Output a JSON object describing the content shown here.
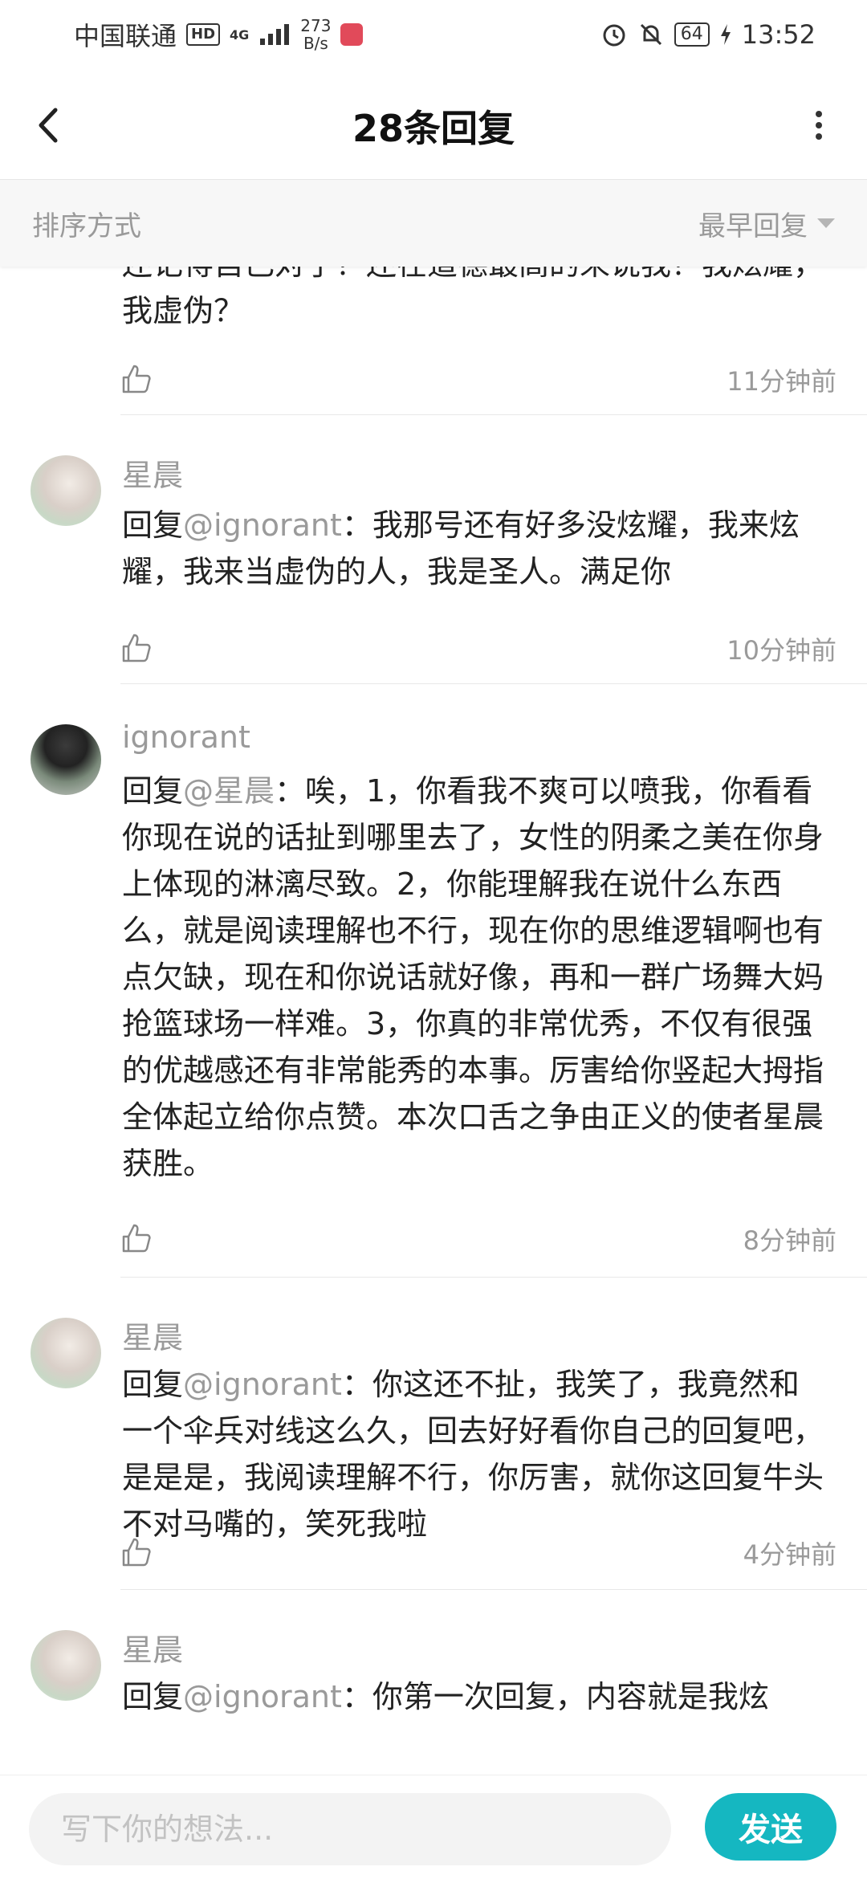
{
  "status_bar": {
    "carrier": "中国联通",
    "hd_badge": "HD",
    "network": "4G",
    "speed_value": "273",
    "speed_unit": "B/s",
    "battery": "64",
    "time": "13:52"
  },
  "header": {
    "title": "28条回复"
  },
  "sort": {
    "label": "排序方式",
    "selected": "最早回复"
  },
  "replies": [
    {
      "content": "还记得自己对了？还在道德最高的来说我？我炫耀，我虚伪？",
      "time": "11分钟前"
    },
    {
      "name": "星晨",
      "prefix": "回复",
      "mention": "@ignorant",
      "text": "：我那号还有好多没炫耀，我来炫耀，我来当虚伪的人，我是圣人。满足你",
      "time": "10分钟前"
    },
    {
      "name": "ignorant",
      "prefix": "回复",
      "mention": "@星晨",
      "text": "：唉，1，你看我不爽可以喷我，你看看你现在说的话扯到哪里去了，女性的阴柔之美在你身上体现的淋漓尽致。2，你能理解我在说什么东西么，就是阅读理解也不行，现在你的思维逻辑啊也有点欠缺，现在和你说话就好像，再和一群广场舞大妈抢篮球场一样难。3，你真的非常优秀，不仅有很强的优越感还有非常能秀的本事。厉害给你竖起大拇指全体起立给你点赞。本次口舌之争由正义的使者星晨获胜。",
      "time": "8分钟前"
    },
    {
      "name": "星晨",
      "prefix": "回复",
      "mention": "@ignorant",
      "text": "：你这还不扯，我笑了，我竟然和一个伞兵对线这么久，回去好好看你自己的回复吧，是是是，我阅读理解不行，你厉害，就你这回复牛头不对马嘴的，笑死我啦",
      "time": "4分钟前"
    },
    {
      "name": "星晨",
      "prefix": "回复",
      "mention": "@ignorant",
      "text": "：你第一次回复，内容就是我炫"
    }
  ],
  "composer": {
    "placeholder": "写下你的想法...",
    "send_label": "发送"
  },
  "colors": {
    "accent": "#15b7c1",
    "muted": "#9a9a9a"
  }
}
